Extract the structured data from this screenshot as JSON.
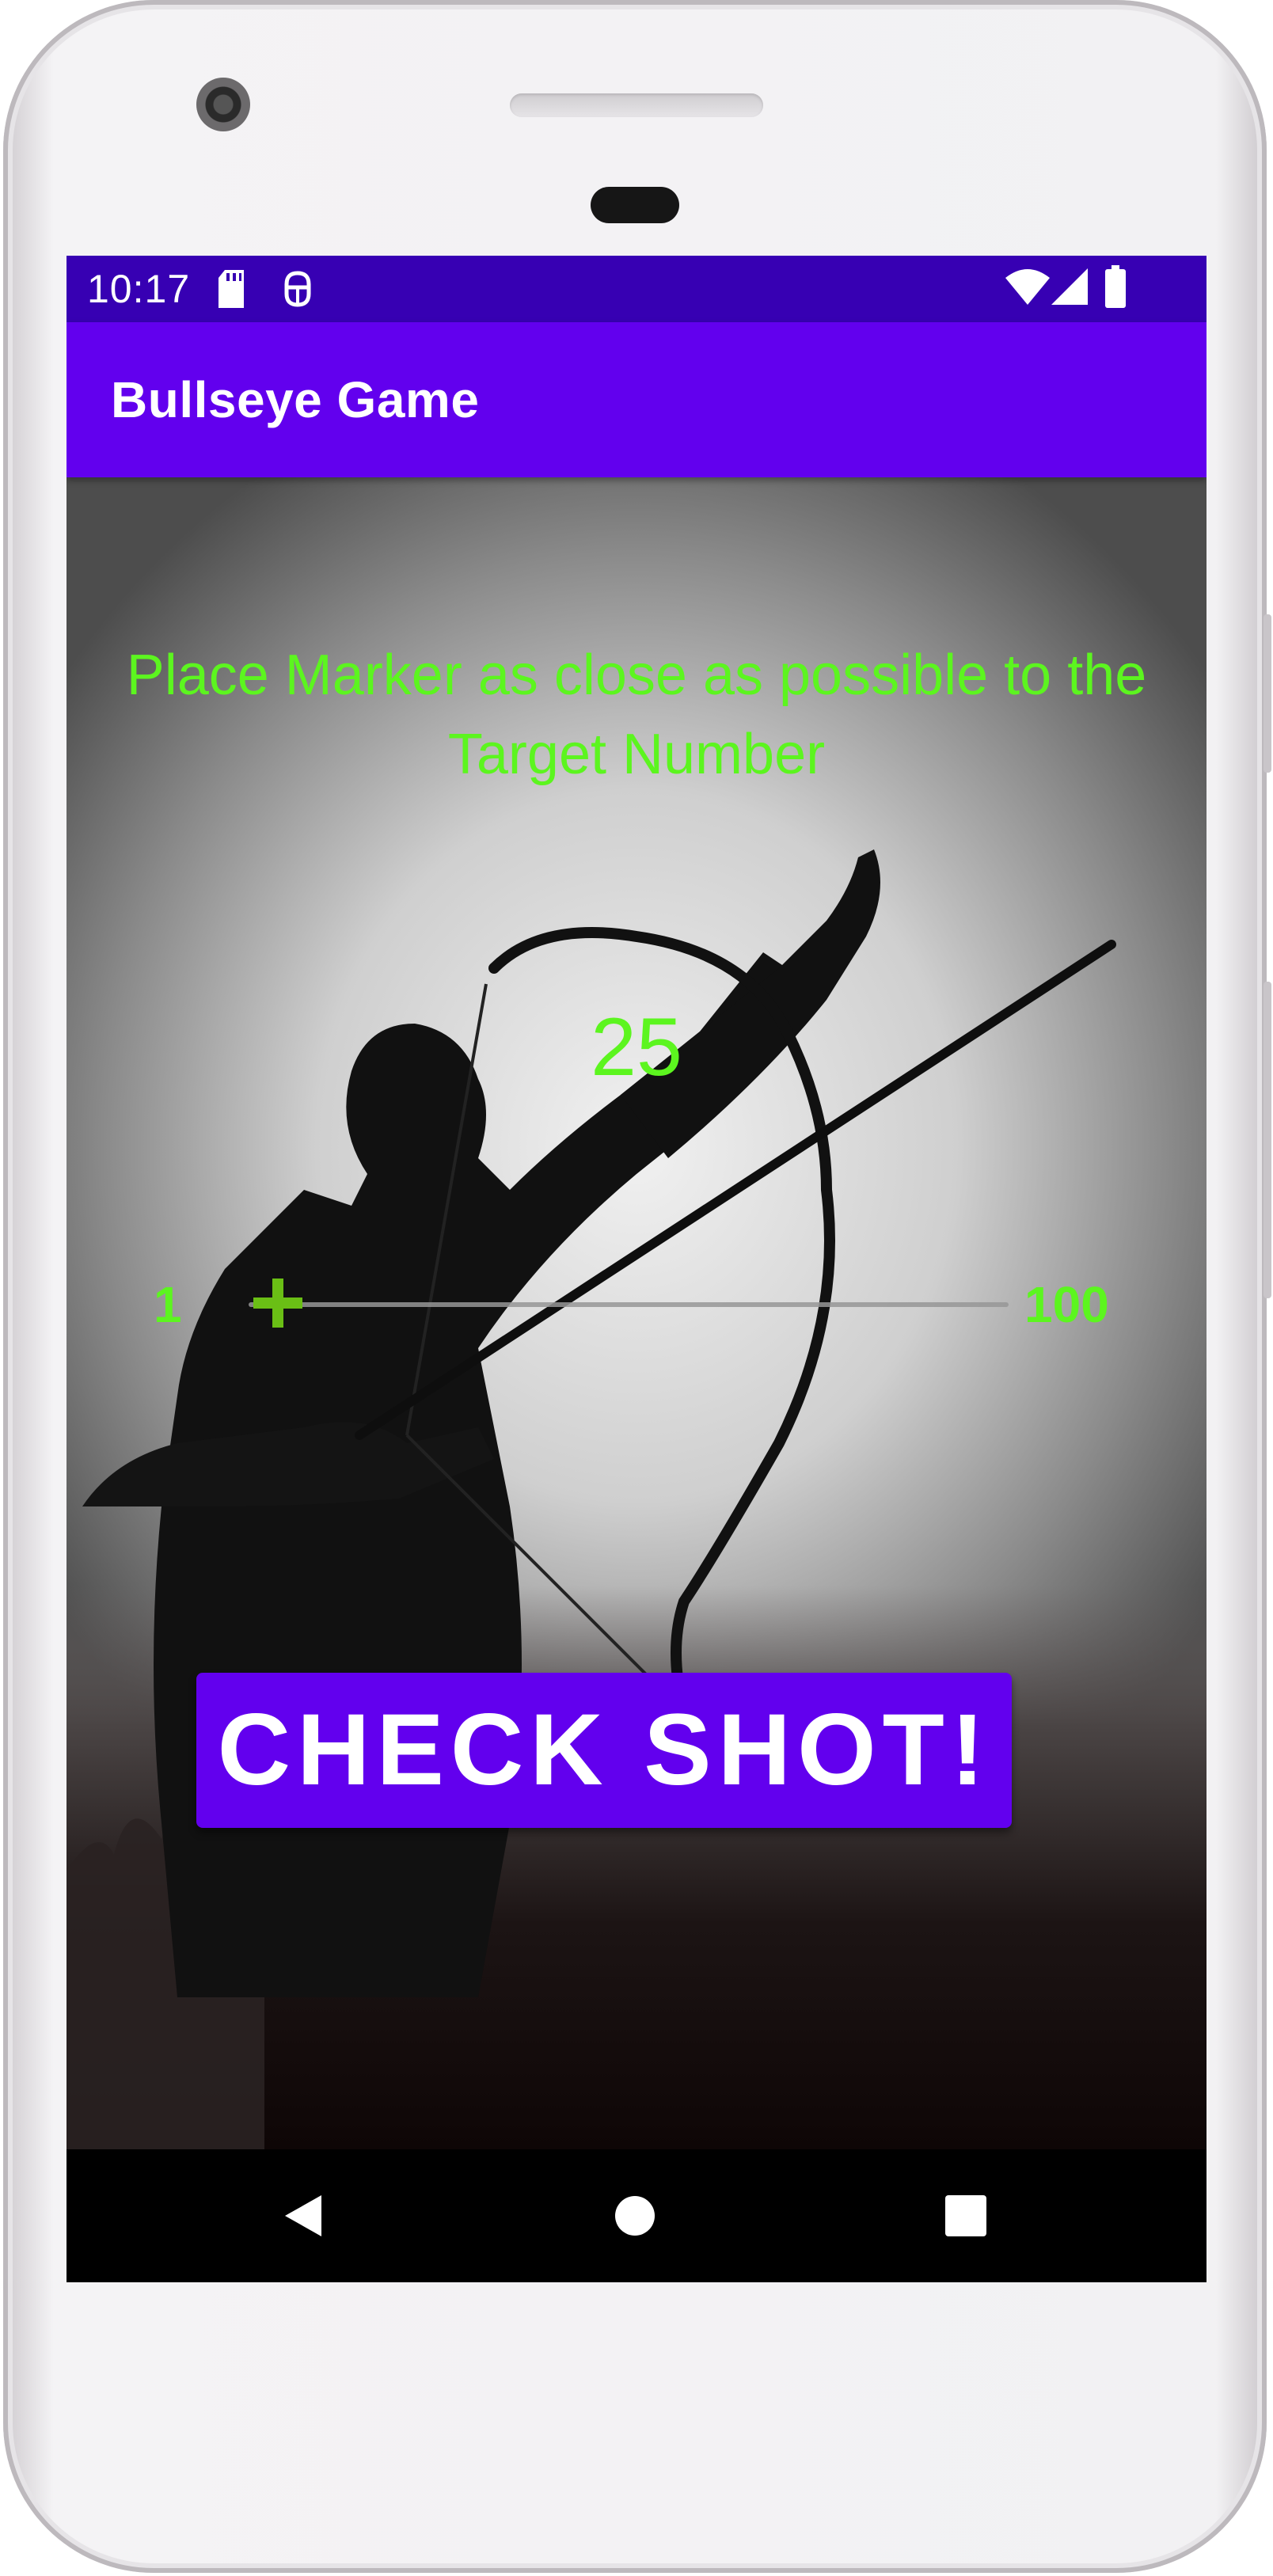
{
  "status_bar": {
    "time": "10:17",
    "icons": [
      "sd-card-icon",
      "android-debug-icon",
      "wifi-icon",
      "signal-icon",
      "battery-icon"
    ]
  },
  "app_bar": {
    "title": "Bullseye Game"
  },
  "game": {
    "instructions": "Place Marker as close as possible to the Target Number",
    "target_number": "25",
    "slider": {
      "min_label": "1",
      "max_label": "100",
      "value": 1
    },
    "check_button_label": "CHECK SHOT!"
  },
  "nav_bar": {
    "icons": [
      "back-icon",
      "home-icon",
      "recents-icon"
    ]
  },
  "colors": {
    "status_bar": "#3700b3",
    "app_bar": "#6200ee",
    "accent_text": "#5cf51f",
    "button": "#6200ee"
  }
}
